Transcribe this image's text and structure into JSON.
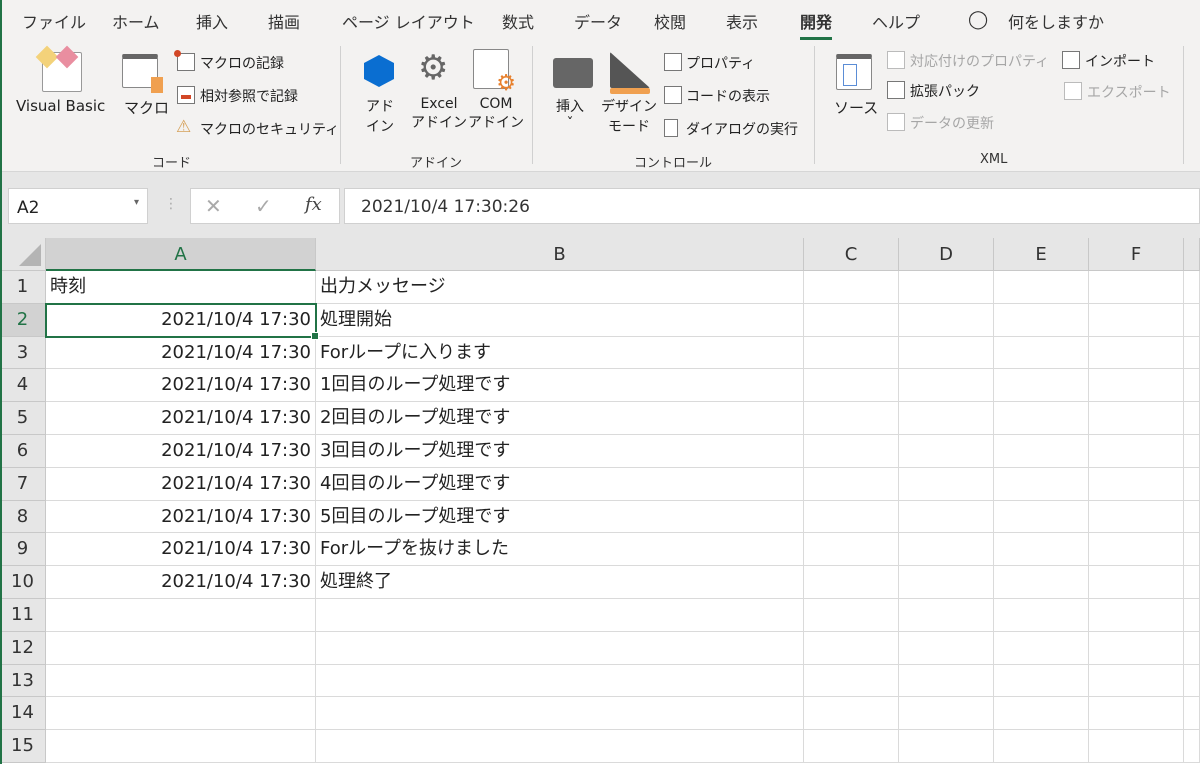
{
  "tabs": [
    "ファイル",
    "ホーム",
    "挿入",
    "描画",
    "ページ レイアウト",
    "数式",
    "データ",
    "校閲",
    "表示",
    "開発",
    "ヘルプ"
  ],
  "active_tab": "開発",
  "tell_me": "何をしますか",
  "ribbon": {
    "code": {
      "label": "コード",
      "visual_basic": "Visual Basic",
      "macro": "マクロ",
      "record_macro": "マクロの記録",
      "relative_ref": "相対参照で記録",
      "macro_security": "マクロのセキュリティ"
    },
    "addins": {
      "label": "アドイン",
      "addin_1": "アド",
      "addin_2": "イン",
      "excel_1": "Excel",
      "excel_2": "アドイン",
      "com_1": "COM",
      "com_2": "アドイン"
    },
    "controls": {
      "label": "コントロール",
      "insert": "挿入",
      "design_1": "デザイン",
      "design_2": "モード",
      "properties": "プロパティ",
      "view_code": "コードの表示",
      "run_dialog": "ダイアログの実行"
    },
    "xml": {
      "label": "XML",
      "source": "ソース",
      "map_properties": "対応付けのプロパティ",
      "expansion_packs": "拡張パック",
      "refresh_data": "データの更新",
      "import": "インポート",
      "export": "エクスポート"
    }
  },
  "name_box": "A2",
  "formula": "2021/10/4  17:30:26",
  "columns": [
    "A",
    "B",
    "C",
    "D",
    "E",
    "F"
  ],
  "rows": [
    {
      "n": "1",
      "a": "時刻",
      "b": "出力メッセージ"
    },
    {
      "n": "2",
      "a": "2021/10/4 17:30",
      "b": "処理開始"
    },
    {
      "n": "3",
      "a": "2021/10/4 17:30",
      "b": "Forループに入ります"
    },
    {
      "n": "4",
      "a": "2021/10/4 17:30",
      "b": "1回目のループ処理です"
    },
    {
      "n": "5",
      "a": "2021/10/4 17:30",
      "b": "2回目のループ処理です"
    },
    {
      "n": "6",
      "a": "2021/10/4 17:30",
      "b": "3回目のループ処理です"
    },
    {
      "n": "7",
      "a": "2021/10/4 17:30",
      "b": "4回目のループ処理です"
    },
    {
      "n": "8",
      "a": "2021/10/4 17:30",
      "b": "5回目のループ処理です"
    },
    {
      "n": "9",
      "a": "2021/10/4 17:30",
      "b": "Forループを抜けました"
    },
    {
      "n": "10",
      "a": "2021/10/4 17:30",
      "b": "処理終了"
    },
    {
      "n": "11",
      "a": "",
      "b": ""
    },
    {
      "n": "12",
      "a": "",
      "b": ""
    },
    {
      "n": "13",
      "a": "",
      "b": ""
    },
    {
      "n": "14",
      "a": "",
      "b": ""
    },
    {
      "n": "15",
      "a": "",
      "b": ""
    }
  ],
  "colors": {
    "accent": "#217346"
  }
}
